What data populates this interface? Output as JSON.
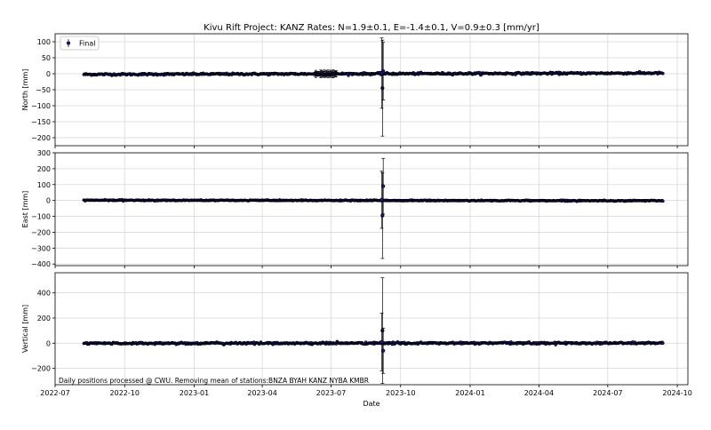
{
  "chart_data": {
    "type": "scatter",
    "title": "Kivu Rift Project: KANZ  Rates: N=1.9±0.1, E=-1.4±0.1, V=0.9±0.3 [mm/yr]",
    "xlabel": "Date",
    "x_range": [
      "2022-07-01",
      "2024-10-15"
    ],
    "x_ticks": [
      "2022-07",
      "2022-10",
      "2023-01",
      "2023-04",
      "2023-07",
      "2023-10",
      "2024-01",
      "2024-04",
      "2024-07",
      "2024-10"
    ],
    "data_range": [
      "2022-08-08",
      "2024-09-12"
    ],
    "legend": {
      "label": "Final",
      "position": "top-left"
    },
    "footnote": "Daily positions processed @ CWU. Removing mean of stations:BNZA BYAH KANZ NYBA KMBR",
    "grid": true,
    "colors": {
      "points": "#1a1a8c",
      "line": "#3b3bd6",
      "errorbar": "#000000",
      "grid": "#d9d9d9"
    },
    "panels": [
      {
        "ylabel": "North [mm]",
        "ylim": [
          -225,
          125
        ],
        "yticks": [
          100,
          50,
          0,
          -50,
          -100,
          -150,
          -200
        ],
        "trend_mm_per_yr": 1.9,
        "noise_mm": 1.5,
        "outliers": [
          {
            "date": "2023-09-07",
            "value": -45,
            "err": 150
          },
          {
            "date": "2023-09-08",
            "value": 8,
            "err": 90
          },
          {
            "date": "2023-09-06",
            "value": 2,
            "err": 110
          }
        ],
        "cluster": {
          "start": "2023-06-10",
          "end": "2023-07-08",
          "err": 12
        }
      },
      {
        "ylabel": "East [mm]",
        "ylim": [
          -410,
          300
        ],
        "yticks": [
          300,
          200,
          100,
          0,
          -100,
          -200,
          -300,
          -400
        ],
        "trend_mm_per_yr": -1.4,
        "noise_mm": 1.5,
        "outliers": [
          {
            "date": "2023-09-07",
            "value": -95,
            "err": 270
          },
          {
            "date": "2023-09-08",
            "value": 90,
            "err": 175
          },
          {
            "date": "2023-09-06",
            "value": 5,
            "err": 180
          }
        ],
        "cluster": null
      },
      {
        "ylabel": "Vertical [mm]",
        "ylim": [
          -330,
          560
        ],
        "yticks": [
          400,
          200,
          0,
          -200
        ],
        "trend_mm_per_yr": 0.9,
        "noise_mm": 4,
        "outliers": [
          {
            "date": "2023-09-07",
            "value": 100,
            "err": 420
          },
          {
            "date": "2023-09-08",
            "value": -60,
            "err": 180
          },
          {
            "date": "2023-09-06",
            "value": 10,
            "err": 230
          }
        ],
        "cluster": null
      }
    ]
  }
}
